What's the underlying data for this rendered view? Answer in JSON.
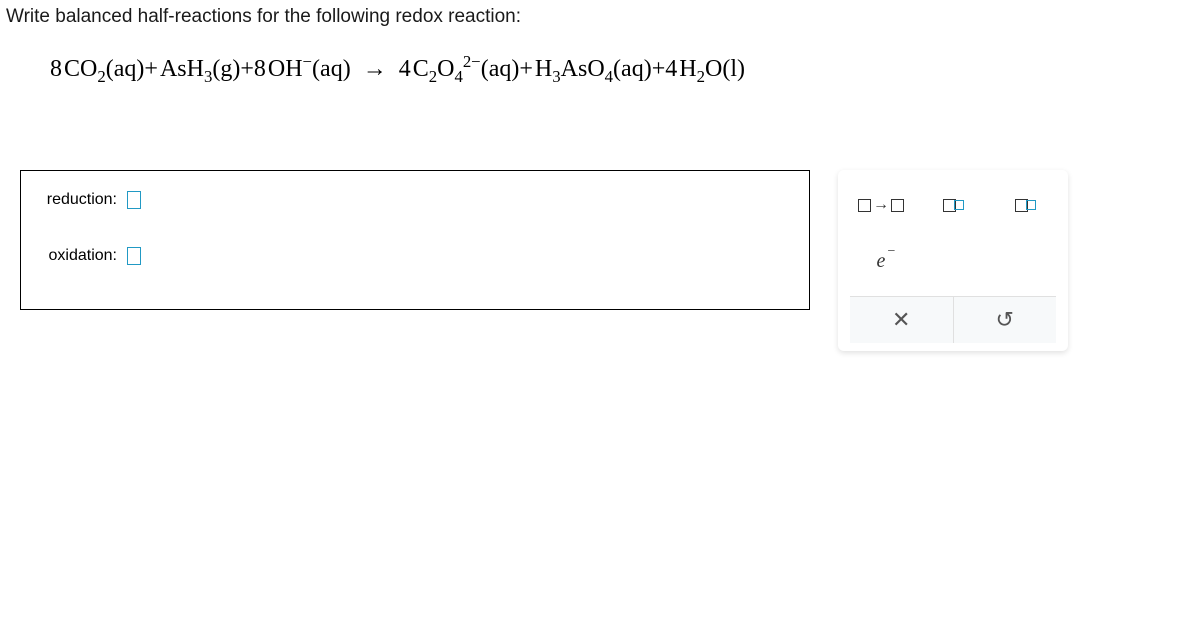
{
  "question": "Write balanced half-reactions for the following redox reaction:",
  "equation": {
    "lhs_1_coef": "8",
    "lhs_1": "CO",
    "lhs_1_sub": "2",
    "lhs_1_state": "(aq)",
    "plus1": "+",
    "lhs_2": "AsH",
    "lhs_2_sub": "3",
    "lhs_2_state": "(g)",
    "plus2": "+",
    "lhs_3_coef": "8",
    "lhs_3": "OH",
    "lhs_3_sup": "−",
    "lhs_3_state": "(aq)",
    "arrow": "→",
    "rhs_1_coef": "4",
    "rhs_1": "C",
    "rhs_1_sub1": "2",
    "rhs_1_mid": "O",
    "rhs_1_sub2": "4",
    "rhs_1_sup": "2−",
    "rhs_1_state": "(aq)",
    "plus3": "+",
    "rhs_2": "H",
    "rhs_2_sub1": "3",
    "rhs_2_mid": "AsO",
    "rhs_2_sub2": "4",
    "rhs_2_state": "(aq)",
    "plus4": "+",
    "rhs_3_coef": "4",
    "rhs_3": "H",
    "rhs_3_sub": "2",
    "rhs_3_mid": "O",
    "rhs_3_state": "(l)"
  },
  "labels": {
    "reduction": "reduction:",
    "oxidation": "oxidation:"
  },
  "tools": {
    "electron": "e"
  }
}
